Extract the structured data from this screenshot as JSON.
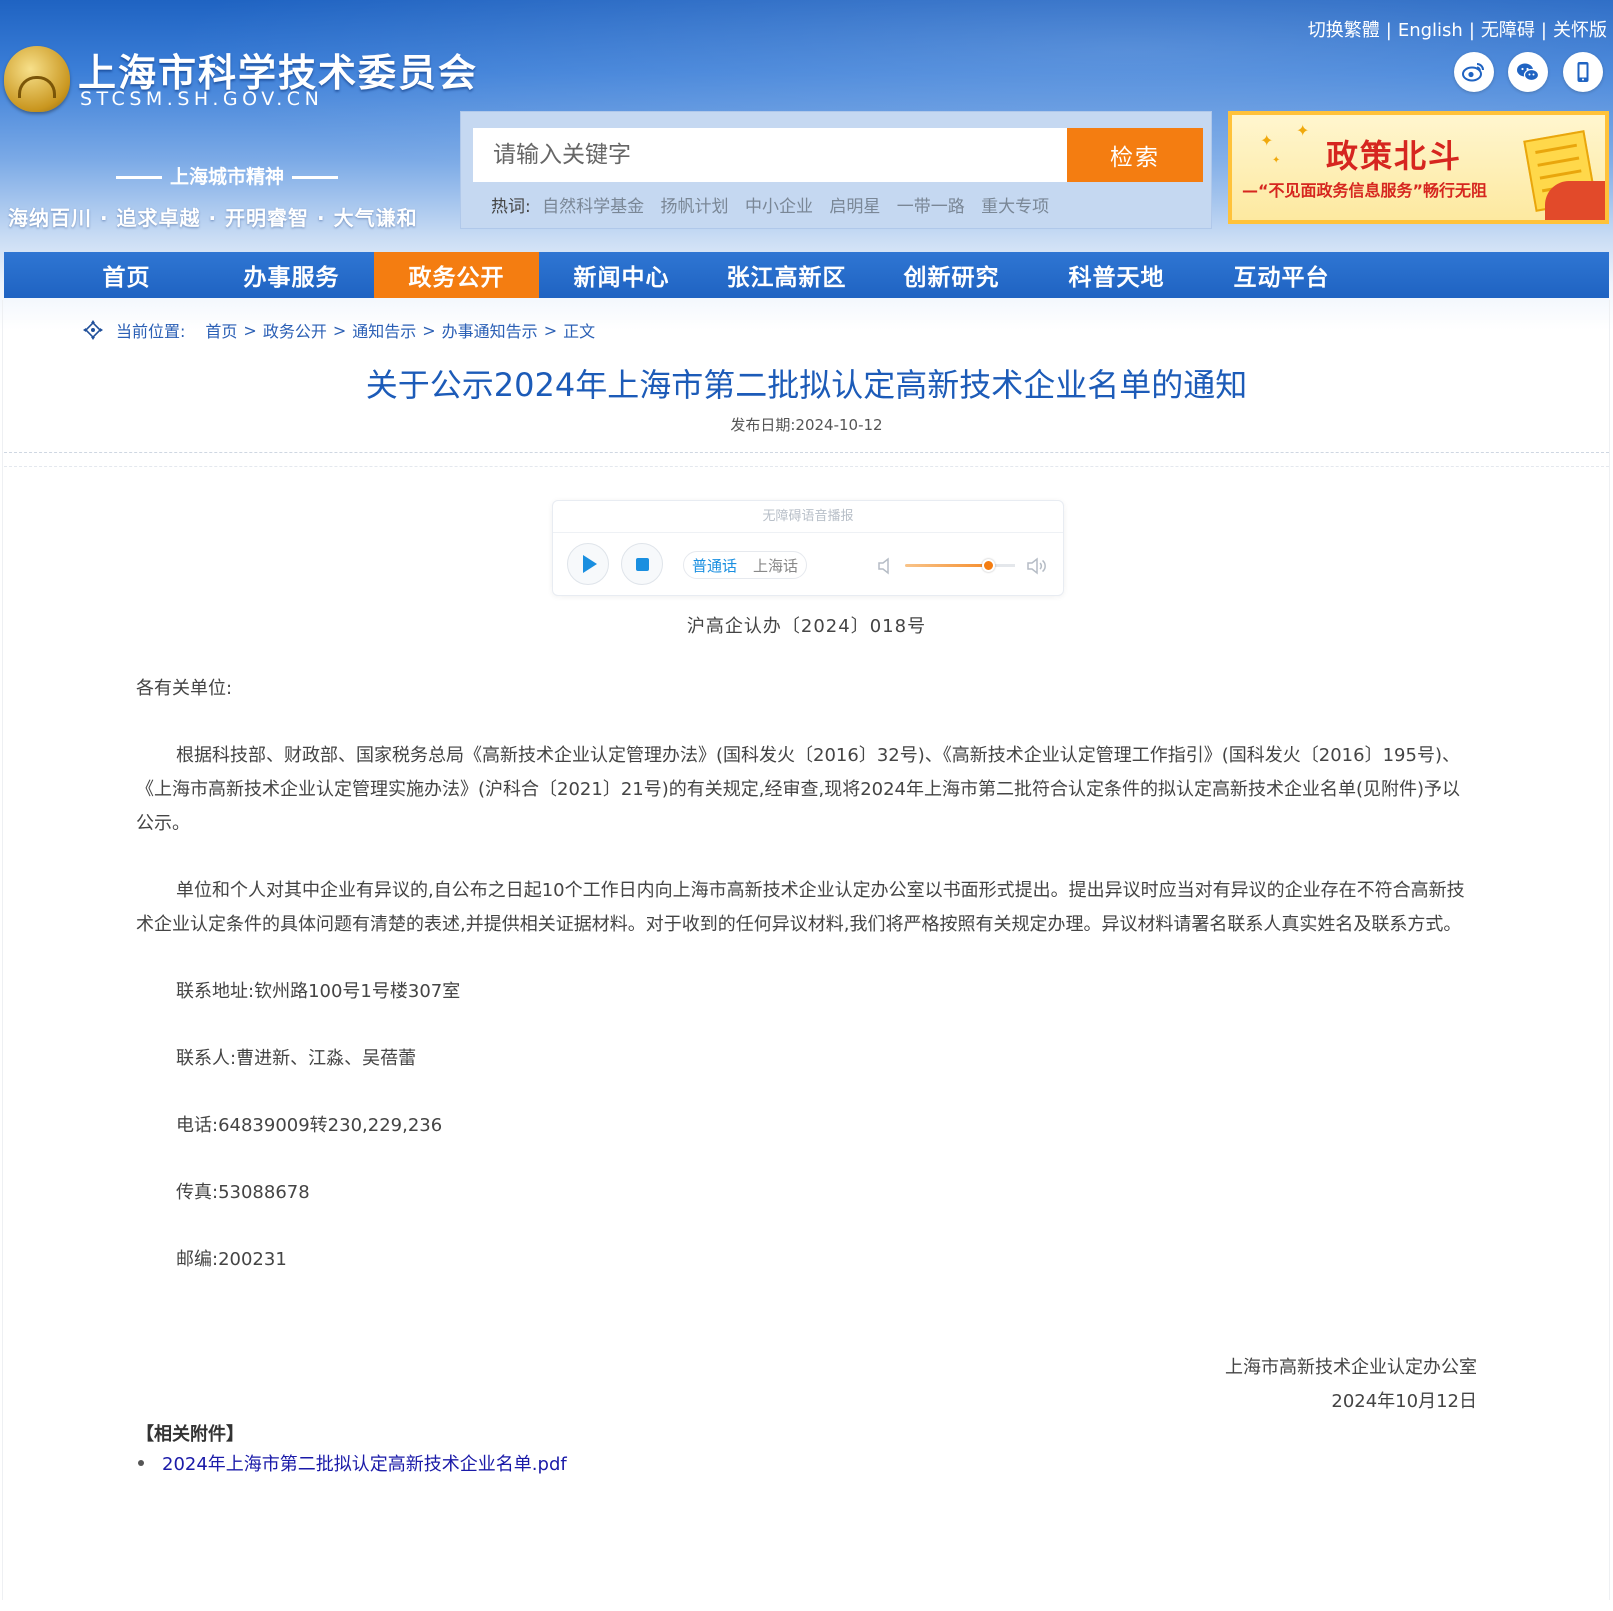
{
  "site": {
    "title": "上海市科学技术委员会",
    "domain": "STCSM.SH.GOV.CN",
    "spirit_title": "上海城市精神",
    "spirit_line": "海纳百川 · 追求卓越 · 开明睿智 · 大气谦和"
  },
  "top_links": [
    "切换繁體",
    "English",
    "无障碍",
    "关怀版"
  ],
  "top_links_sep": "|",
  "social_icons": [
    "weibo-icon",
    "wechat-icon",
    "mobile-icon"
  ],
  "search": {
    "placeholder": "请输入关键字",
    "button": "检索",
    "hot_label": "热词:",
    "hot_words": [
      "自然科学基金",
      "扬帆计划",
      "中小企业",
      "启明星",
      "一带一路",
      "重大专项"
    ]
  },
  "banner": {
    "title": "政策北斗",
    "subtitle": "—“不见面政务信息服务”畅行无阻"
  },
  "nav": {
    "items": [
      "首页",
      "办事服务",
      "政务公开",
      "新闻中心",
      "张江高新区",
      "创新研究",
      "科普天地",
      "互动平台"
    ],
    "active_index": 2
  },
  "breadcrumb": {
    "label": "当前位置:",
    "items": [
      "首页",
      "政务公开",
      "通知告示",
      "办事通知告示",
      "正文"
    ],
    "sep": ">"
  },
  "article": {
    "title": "关于公示2024年上海市第二批拟认定高新技术企业名单的通知",
    "date": "发布日期:2024-10-12",
    "doc_no": "沪高企认办〔2024〕018号",
    "salutation": "各有关单位:",
    "para1": "根据科技部、财政部、国家税务总局《高新技术企业认定管理办法》(国科发火〔2016〕32号)、《高新技术企业认定管理工作指引》(国科发火〔2016〕195号)、《上海市高新技术企业认定管理实施办法》(沪科合〔2021〕21号)的有关规定,经审查,现将2024年上海市第二批符合认定条件的拟认定高新技术企业名单(见附件)予以公示。",
    "para2": "单位和个人对其中企业有异议的,自公布之日起10个工作日内向上海市高新技术企业认定办公室以书面形式提出。提出异议时应当对有异议的企业存在不符合高新技术企业认定条件的具体问题有清楚的表述,并提供相关证据材料。对于收到的任何异议材料,我们将严格按照有关规定办理。异议材料请署名联系人真实姓名及联系方式。",
    "address": "联系地址:钦州路100号1号楼307室",
    "contact": "联系人:曹进新、江淼、吴蓓蕾",
    "phone": "电话:64839009转230,229,236",
    "fax": "传真:53088678",
    "postcode": "邮编:200231",
    "signer": "上海市高新技术企业认定办公室",
    "sign_date": "2024年10月12日",
    "attachments_title": "【相关附件】",
    "attachments": [
      "2024年上海市第二批拟认定高新技术企业名单.pdf"
    ]
  },
  "player": {
    "header": "无障碍语音播报",
    "lang_options": [
      "普通话",
      "上海话"
    ],
    "active_lang": 0,
    "volume": 0.75
  }
}
